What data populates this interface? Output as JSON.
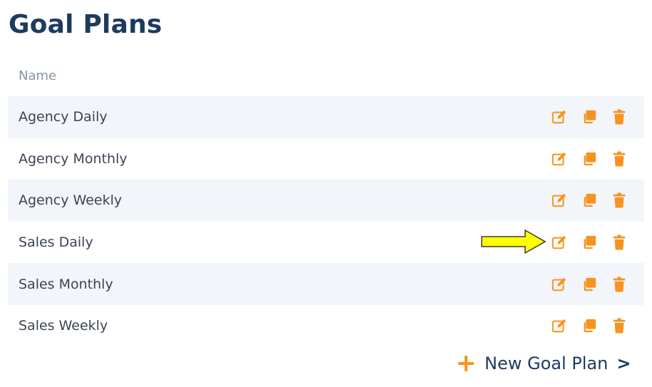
{
  "page": {
    "title": "Goal Plans"
  },
  "table": {
    "header_name": "Name",
    "rows": [
      {
        "name": "Agency Daily"
      },
      {
        "name": "Agency Monthly"
      },
      {
        "name": "Agency Weekly"
      },
      {
        "name": "Sales Daily"
      },
      {
        "name": "Sales Monthly"
      },
      {
        "name": "Sales Weekly"
      }
    ]
  },
  "actions": {
    "icons": [
      "edit-icon",
      "copy-icon",
      "trash-icon"
    ],
    "color": "#f7931e"
  },
  "footer": {
    "new_plan_label": "New Goal Plan",
    "chevron": ">"
  },
  "annotation": {
    "highlight_row": "Sales Daily",
    "arrow_color": "#ffff00"
  }
}
